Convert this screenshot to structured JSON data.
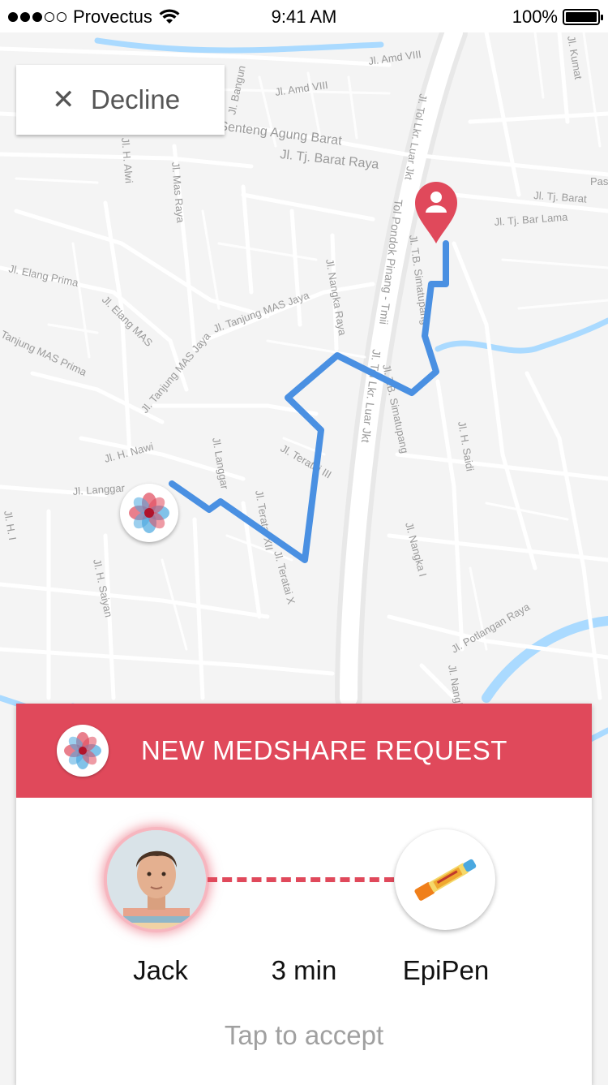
{
  "status_bar": {
    "carrier": "Provectus",
    "time": "9:41 AM",
    "battery": "100%",
    "signal_bars_filled": 3,
    "signal_bars_total": 5
  },
  "decline": {
    "icon": "close-icon",
    "label": "Decline"
  },
  "map": {
    "street_labels": [
      "Jl. Bangun",
      "Jl. Amd VIII",
      "Jl. Amd VIII",
      "Senteng Agung Barat",
      "Jl. Tj. Barat Raya",
      "Jl. Tol Lkr. Luar Jkt",
      "Jl. Tj. Barat",
      "Jl. Tj. Bar Lama",
      "Jl. H. Alwi",
      "Jl. Mas Raya",
      "Jl. Elang Prima",
      "Jl. Elang MAS",
      "Jl. Tanjung MAS Jaya",
      "Jl. Tanjung MAS Jaya",
      "Tanjung MAS Prima",
      "Jl. Nangka Raya",
      "Jl. T.B. Simatupang",
      "Tol Pondok Pinang - Tmii",
      "Jl. Tol Lkr. Luar Jkt",
      "Jl. T.B. Simatupang",
      "Jl. H. Saidi",
      "Jl. H. Nawi",
      "Jl. Langgar",
      "Jl. Langgar",
      "Jl. Teratai III",
      "Jl. Teratai XII",
      "Jl. Teratai X",
      "Jl. H. Saiyan",
      "Jl. Nangka I",
      "Jl. Potlangan Raya",
      "Jl. Nangka",
      "Pas",
      "Jl. H. I",
      "Jl. Kumat"
    ],
    "route_color": "#4a90e2",
    "water_color": "#aadaff",
    "accent_color": "#e0495b"
  },
  "request": {
    "header_title": "NEW MEDSHARE REQUEST",
    "user_name": "Jack",
    "eta": "3 min",
    "item_name": "EpiPen",
    "accept_hint": "Tap to accept"
  }
}
